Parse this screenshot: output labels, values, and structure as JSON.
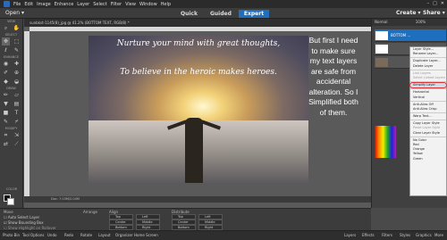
{
  "menubar": {
    "items": [
      "File",
      "Edit",
      "Image",
      "Enhance",
      "Layer",
      "Select",
      "Filter",
      "View",
      "Window",
      "Help"
    ],
    "controls": [
      "Minimize",
      "Maximize",
      "Close"
    ]
  },
  "modebar": {
    "open": "Open",
    "modes": [
      "Quick",
      "Guided",
      "Expert"
    ],
    "create": "Create",
    "share": "Share"
  },
  "document": {
    "tab": "sunbkst-1145(8)_jpg @ 41.2% (BOTTOM TEXT, RGB/8) *",
    "status": "Doc: 7.03M/2.04M"
  },
  "canvas": {
    "quote_line1": "Nurture your mind with great thoughts,",
    "quote_line2": "To believe in the heroic makes heroes."
  },
  "note": {
    "text": "But first I need to make sure my text layers are safe from accidental alteration. So I Simplified both of them."
  },
  "tool_sections": [
    "VIEW",
    "SELECT",
    "ENHANCE",
    "DRAW",
    "MODIFY",
    "COLOR"
  ],
  "layers": {
    "mode": "Normal",
    "opacity": "100%",
    "selected": "BOTTOM ..."
  },
  "context_menu": {
    "items": [
      "Layer Style...",
      "Rename Layer...",
      "Duplicate Layer...",
      "Delete Layer",
      "Link Layers",
      "Select Linked Layers",
      "Simplify Layer",
      "Horizontal",
      "Vertical",
      "Anti-Alias Off",
      "Anti-Alias Crisp",
      "Warp Text...",
      "Copy Layer Style",
      "Paste Layer Style",
      "Clear Layer Style",
      "No Color",
      "Red",
      "Orange",
      "Yellow",
      "Green"
    ],
    "highlighted": "Simplify Layer"
  },
  "tool_options": {
    "move": "Move",
    "auto_select": "Auto Select Layer",
    "bounding": "Show Bounding Box",
    "highlight": "Show Highlight on Rollover",
    "arrange": "Arrange",
    "align": "Align",
    "distribute": "Distribute",
    "align_btns": [
      "Top",
      "Center",
      "Bottom",
      "Left",
      "Middle",
      "Right"
    ],
    "arrange_btns": [
      "Forward",
      "Backward",
      "To Front",
      "To Back"
    ]
  },
  "taskbar": {
    "left": [
      "Photo Bin",
      "Tool Options",
      "Undo",
      "Redo",
      "Rotate",
      "Layout",
      "Organizer",
      "Home Screen"
    ],
    "right": [
      "Layers",
      "Effects",
      "Filters",
      "Styles",
      "Graphics",
      "More"
    ]
  }
}
